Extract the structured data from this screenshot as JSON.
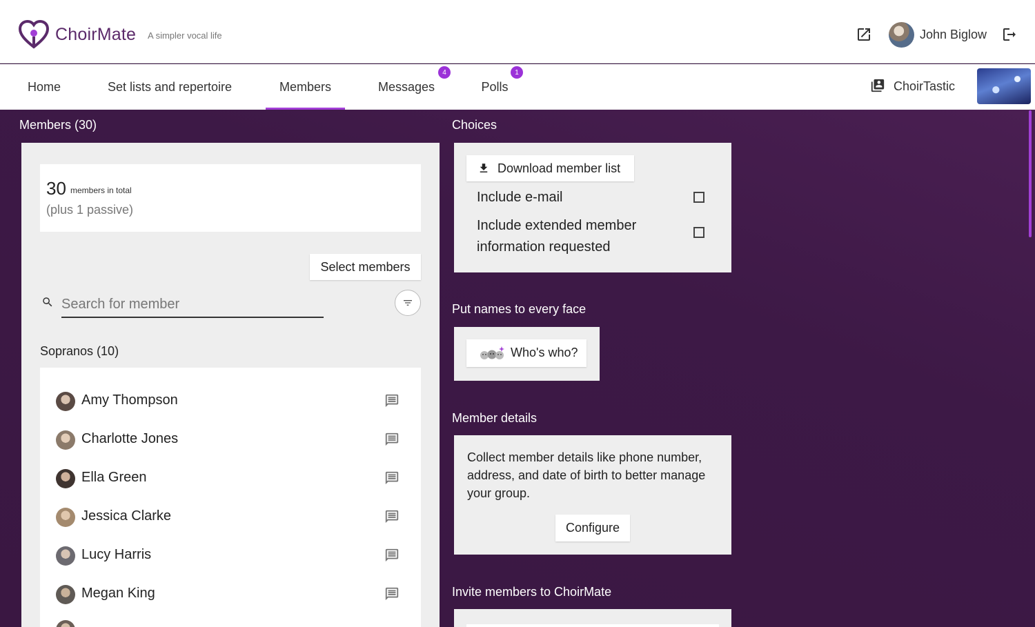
{
  "header": {
    "brand": "ChoirMate",
    "tagline": "A simpler vocal life",
    "user_name": "John Biglow"
  },
  "nav": {
    "items": [
      {
        "label": "Home"
      },
      {
        "label": "Set lists and repertoire"
      },
      {
        "label": "Members",
        "active": true
      },
      {
        "label": "Messages",
        "badge": "4"
      },
      {
        "label": "Polls",
        "badge": "1"
      }
    ],
    "choir_name": "ChoirTastic"
  },
  "members_panel": {
    "title": "Members (30)",
    "total_count": "30",
    "total_label": "members in total",
    "passive_text": "(plus 1 passive)",
    "select_button": "Select members",
    "search_placeholder": "Search for member",
    "group_title": "Sopranos (10)",
    "members": [
      {
        "name": "Amy Thompson"
      },
      {
        "name": "Charlotte Jones"
      },
      {
        "name": "Ella Green"
      },
      {
        "name": "Jessica Clarke"
      },
      {
        "name": "Lucy Harris"
      },
      {
        "name": "Megan King"
      }
    ]
  },
  "choices": {
    "title": "Choices",
    "download_button": "Download member list",
    "include_email": "Include e-mail",
    "include_extended": "Include extended member information requested"
  },
  "faces": {
    "title": "Put names to every face",
    "button": "Who's who?"
  },
  "member_details": {
    "title": "Member details",
    "description": "Collect member details like phone number, address, and date of birth to better manage your group.",
    "configure_button": "Configure"
  },
  "invite": {
    "title": "Invite members to ChoirMate"
  },
  "colors": {
    "accent": "#a23fd6",
    "background": "#3e1a47",
    "badge": "#9b32d8"
  }
}
